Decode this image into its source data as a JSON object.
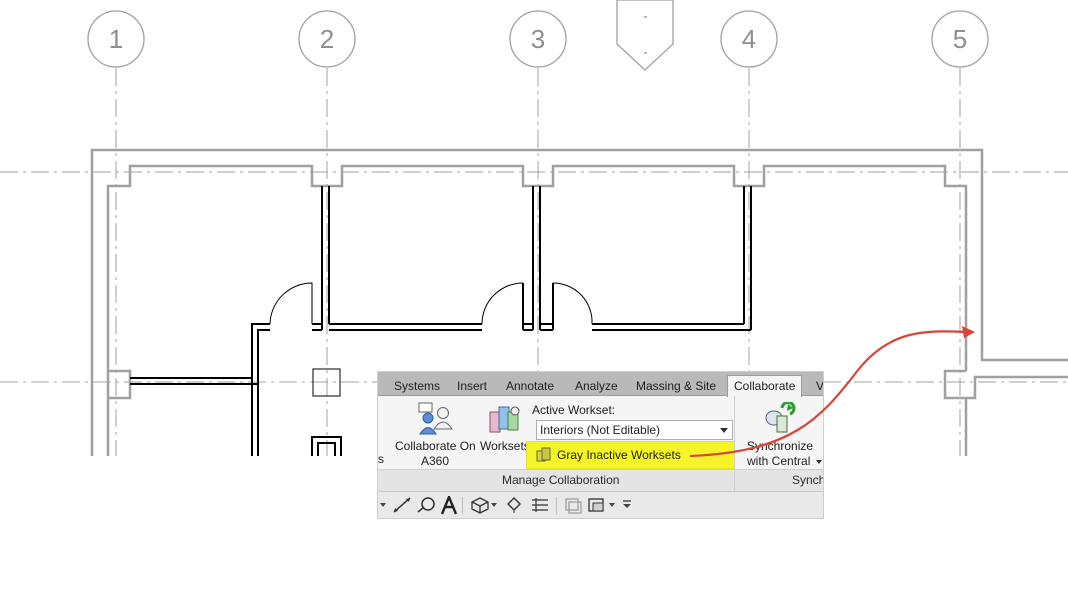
{
  "grid": {
    "labels": [
      "1",
      "2",
      "3",
      "4",
      "5"
    ]
  },
  "ribbon": {
    "tabs": [
      "Systems",
      "Insert",
      "Annotate",
      "Analyze",
      "Massing & Site",
      "Collaborate",
      "V"
    ],
    "active_tab": "Collaborate",
    "partial_left_text": "s",
    "collaborate_a360": {
      "line1": "Collaborate On",
      "line2": "A360"
    },
    "worksets_label": "Worksets",
    "active_workset_label": "Active Workset:",
    "active_workset_value": "Interiors (Not Editable)",
    "gray_inactive_label": "Gray Inactive Worksets",
    "synchronize": {
      "line1": "Synchronize",
      "line2": "with Central"
    },
    "panel_titles": {
      "manage": "Manage Collaboration",
      "sync": "Synch"
    }
  },
  "colors": {
    "highlight": "#f4f427",
    "callout_arrow": "#d9443a",
    "wall": "#000000",
    "gridline": "#a0a0a0",
    "ribbon_tab_bar": "#b9b9b9"
  },
  "icons": {
    "collaborate": "collaborate-on-a360-icon",
    "worksets": "worksets-icon",
    "gray_inactive": "gray-inactive-worksets-icon",
    "synchronize": "synchronize-icon",
    "qat": [
      "measure-icon",
      "tag-icon",
      "text-icon",
      "3d-view-icon",
      "section-icon",
      "thin-lines-icon",
      "close-hidden-icon",
      "switch-windows-icon",
      "customize-qat-icon"
    ]
  }
}
